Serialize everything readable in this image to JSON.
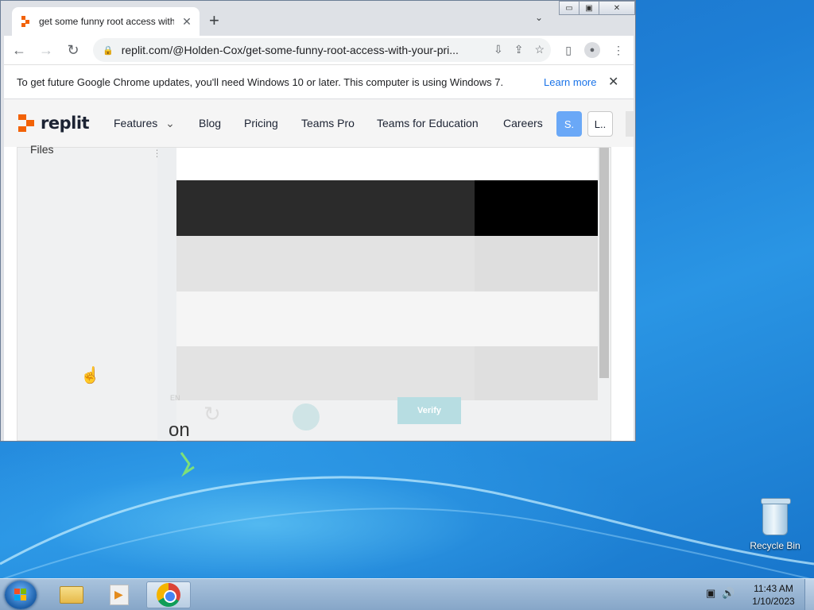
{
  "browser": {
    "tab_title": "get some funny root access with",
    "tab_close": "✕",
    "new_tab": "+",
    "tab_menu": "⌄",
    "window_buttons": {
      "minimize": "▭",
      "maximize": "▣",
      "close": "✕"
    },
    "url": "replit.com/@Holden-Cox/get-some-funny-root-access-with-your-pri...",
    "lock_icon": "🔒",
    "infobar_text": "To get future Google Chrome updates, you'll need Windows 10 or later. This computer is using Windows 7.",
    "learn_more": "Learn more",
    "infobar_close": "✕"
  },
  "site": {
    "logo_text": "replit",
    "nav": [
      "Features",
      "Blog",
      "Pricing",
      "Teams Pro",
      "Teams for Education",
      "Careers"
    ],
    "features_chevron": "⌄",
    "btn_s": "S.",
    "btn_l": "L.."
  },
  "ide": {
    "files_label": "Files",
    "files_menu": "⋮",
    "captcha_en": "EN",
    "captcha_verify": "Verify",
    "captcha_fragment": "on"
  },
  "desktop": {
    "recycle_bin": "Recycle Bin"
  },
  "taskbar": {
    "time": "11:43 AM",
    "date": "1/10/2023"
  },
  "colors": {
    "replit_orange": "#f26207",
    "chrome_link": "#1a73e8",
    "s_button": "#6aa8f7"
  }
}
